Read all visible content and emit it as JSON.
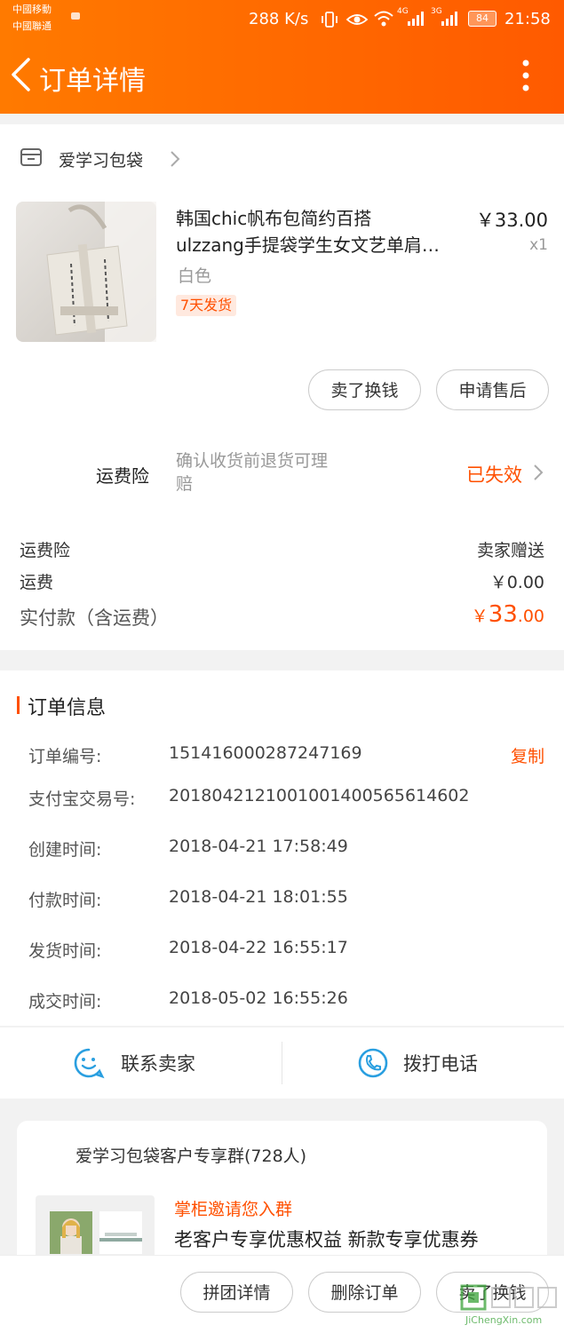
{
  "status_bar": {
    "carrier1": "中國移動",
    "carrier2": "中國聯通",
    "speed": "288 K/s",
    "net1": "4G",
    "net2": "3G",
    "battery": "84",
    "time": "21:58"
  },
  "header": {
    "title": "订单详情"
  },
  "shop": {
    "name": "爱学习包袋"
  },
  "product": {
    "title_line1": "韩国chic帆布包简约百搭",
    "title_line2": "ulzzang手提袋学生女文艺单肩…",
    "price": "￥33.00",
    "qty": "x1",
    "variant": "白色",
    "tag": "7天发货"
  },
  "item_actions": {
    "sell": "卖了换钱",
    "after_sale": "申请售后"
  },
  "insurance": {
    "label": "运费险",
    "desc_line1": "确认收货前退货可理",
    "desc_line2": "赔",
    "status": "已失效"
  },
  "summary": {
    "insurance_label": "运费险",
    "insurance_value": "卖家赠送",
    "shipping_label": "运费",
    "shipping_value": "￥0.00",
    "paid_label": "实付款（含运费）",
    "paid_symbol": "￥",
    "paid_int": "33",
    "paid_dec": ".00"
  },
  "order_info": {
    "title": "订单信息",
    "copy": "复制",
    "rows": [
      {
        "label": "订单编号:",
        "value": "151416000287247169"
      },
      {
        "label": "支付宝交易号:",
        "value": "2018042121001001400565614602"
      },
      {
        "label": "创建时间:",
        "value": "2018-04-21 17:58:49"
      },
      {
        "label": "付款时间:",
        "value": "2018-04-21 18:01:55"
      },
      {
        "label": "发货时间:",
        "value": "2018-04-22 16:55:17"
      },
      {
        "label": "成交时间:",
        "value": "2018-05-02 16:55:26"
      }
    ]
  },
  "contact": {
    "seller": "联系卖家",
    "call": "拨打电话"
  },
  "group": {
    "title": "爱学习包袋客户专享群(728人)",
    "invite": "掌柜邀请您入群",
    "desc": "老客户专享优惠权益 新款专享优惠券"
  },
  "bottom_bar": {
    "group_detail": "拼团详情",
    "delete": "删除订单",
    "sell": "卖了换钱"
  },
  "watermark": {
    "text": "JiChengXin.com"
  },
  "colors": {
    "accent": "#ff5000",
    "header": "#ff6a00",
    "blue": "#2a9fe0"
  }
}
